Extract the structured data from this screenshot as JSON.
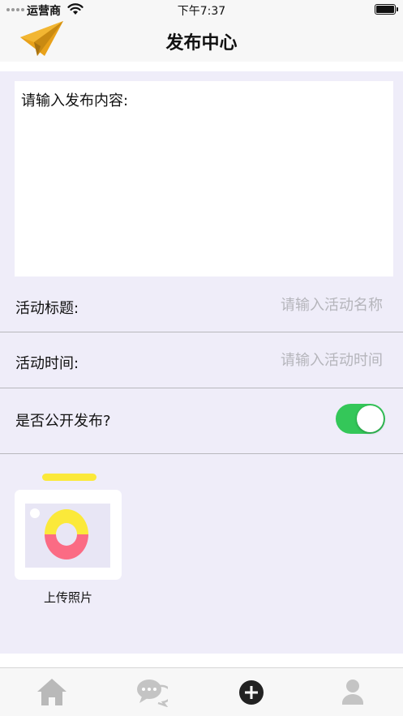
{
  "status_bar": {
    "carrier": "运营商",
    "time": "下午7:37",
    "battery_level": 1.0
  },
  "nav": {
    "title": "发布中心",
    "logo_icon": "paper-plane-icon"
  },
  "form": {
    "content_placeholder": "请输入发布内容:",
    "title_label": "活动标题:",
    "title_placeholder": "请输入活动名称",
    "title_value": "",
    "time_label": "活动时间:",
    "time_placeholder": "请输入活动时间",
    "time_value": "",
    "public_label": "是否公开发布?",
    "public_on": true
  },
  "upload": {
    "label": "上传照片",
    "icon": "camera-icon"
  },
  "tab_bar": {
    "items": [
      {
        "icon": "home-icon"
      },
      {
        "icon": "chat-icon"
      },
      {
        "icon": "add-icon"
      },
      {
        "icon": "profile-icon"
      }
    ]
  },
  "colors": {
    "background": "#efedf9",
    "toggle_on": "#34c759",
    "logo": "#e8a11a",
    "camera_yellow": "#fbe93a",
    "camera_pink": "#fb6b84"
  }
}
